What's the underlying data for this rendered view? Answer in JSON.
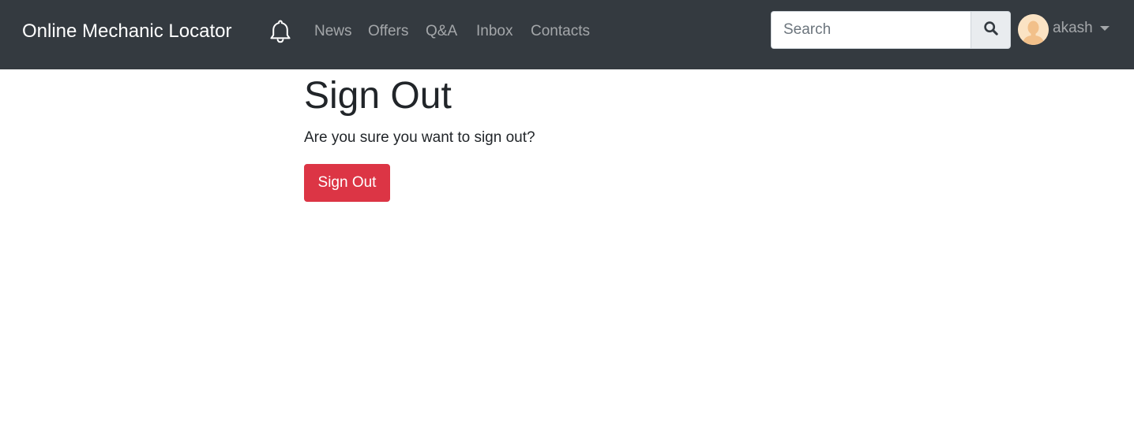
{
  "navbar": {
    "brand": "Online Mechanic Locator",
    "bell_icon": "bell-icon",
    "links": [
      {
        "label": "News"
      },
      {
        "label": "Offers"
      },
      {
        "label": "Q&A"
      },
      {
        "label": "Inbox"
      },
      {
        "label": "Contacts"
      }
    ],
    "search": {
      "placeholder": "Search",
      "value": "",
      "button_icon": "search-icon"
    },
    "user": {
      "name": "akash",
      "avatar_icon": "avatar-icon",
      "dropdown_icon": "caret-down-icon"
    }
  },
  "main": {
    "title": "Sign Out",
    "message": "Are you sure you want to sign out?",
    "button_label": "Sign Out"
  },
  "colors": {
    "navbar_bg": "#343a40",
    "danger": "#dc3545",
    "nav_link": "rgba(255,255,255,0.55)"
  }
}
